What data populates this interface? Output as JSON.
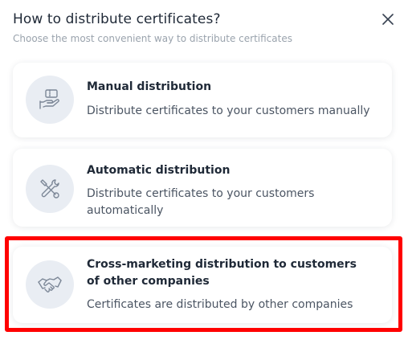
{
  "dialog": {
    "title": "How to distribute certificates?",
    "subtitle": "Choose the most convenient way to distribute certificates",
    "close_label": "X"
  },
  "options": [
    {
      "icon": "hand-ticket-icon",
      "title": "Manual distribution",
      "description": "Distribute certificates to your customers manually"
    },
    {
      "icon": "tools-icon",
      "title": "Automatic distribution",
      "description": "Distribute certificates to your customers automatically"
    },
    {
      "icon": "handshake-icon",
      "title": "Cross-marketing distribution to customers of other companies",
      "description": "Certificates are distributed by other companies",
      "highlighted": true
    }
  ],
  "colors": {
    "icon_bg": "#e9edf3",
    "icon_stroke": "#7c8797",
    "highlight": "#ff0000",
    "title_text": "#1f2937",
    "subtitle_text": "#9aa3ad"
  }
}
